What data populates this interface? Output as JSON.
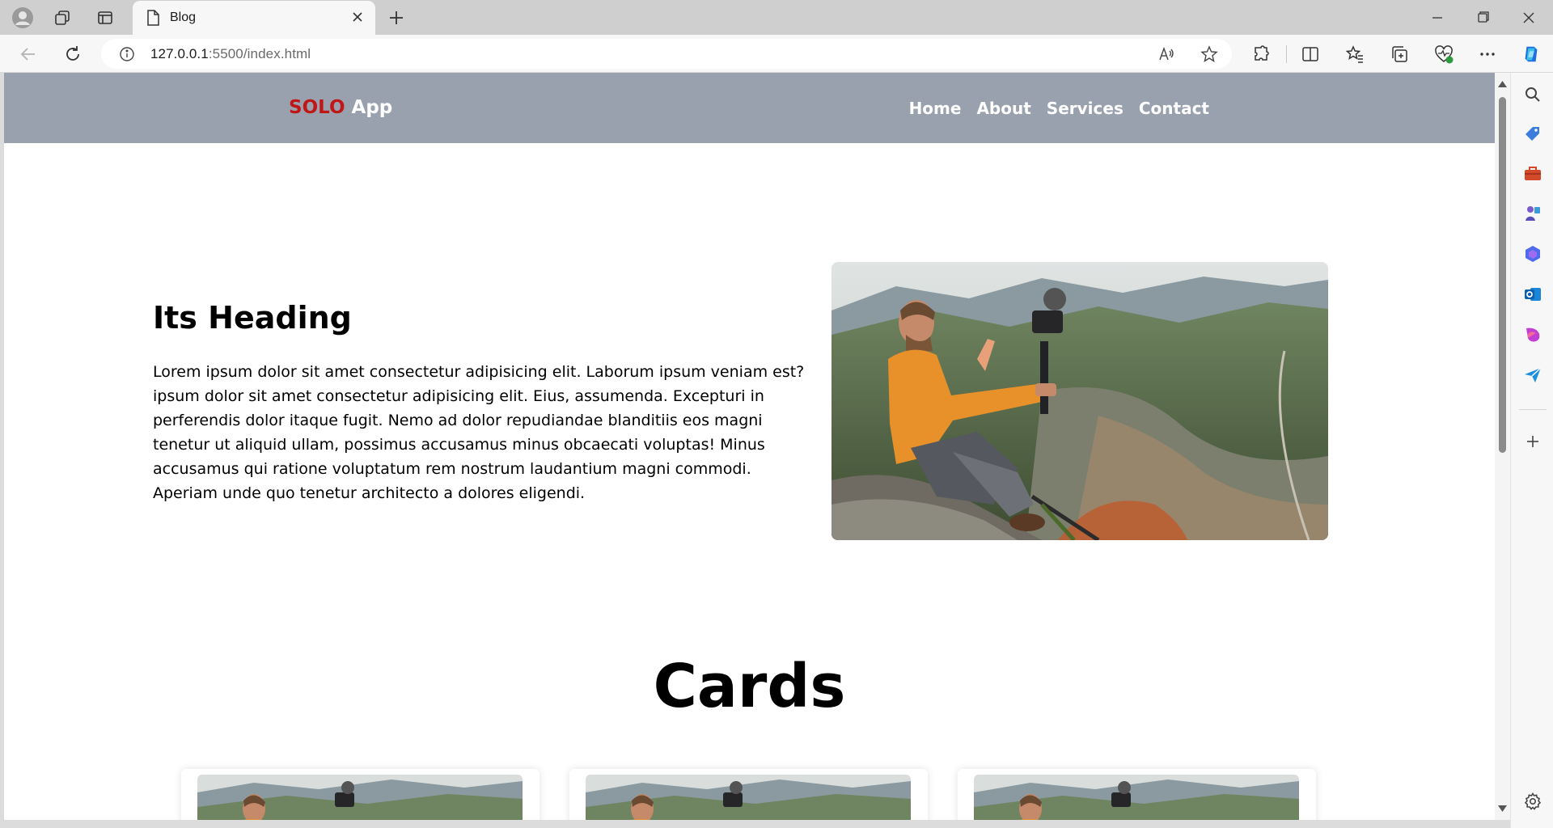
{
  "browser": {
    "tab_title": "Blog",
    "url_host": "127.0.0.1",
    "url_rest": ":5500/index.html"
  },
  "site": {
    "logo_brand": "SOLO",
    "logo_rest": " App",
    "nav": [
      "Home",
      "About",
      "Services",
      "Contact"
    ]
  },
  "hero": {
    "heading": "Its Heading",
    "paragraph": "Lorem ipsum dolor sit amet consectetur adipisicing elit. Laborum ipsum veniam est? ipsum dolor sit amet consectetur adipisicing elit. Eius, assumenda. Excepturi in perferendis dolor itaque fugit. Nemo ad dolor repudiandae blanditiis eos magni tenetur ut aliquid ullam, possimus accusamus minus obcaecati voluptas! Minus accusamus qui ratione voluptatum rem nostrum laudantium magni commodi. Aperiam unde quo tenetur architecto a dolores eligendi."
  },
  "cards_section": {
    "title": "Cards"
  },
  "colors": {
    "header_bg": "#9aa1ae",
    "brand_red": "#c01616"
  }
}
